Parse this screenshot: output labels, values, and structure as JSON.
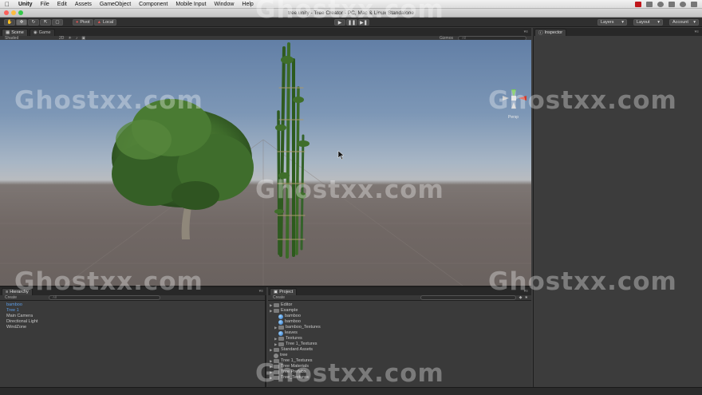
{
  "menubar": {
    "app": "Unity",
    "items": [
      "File",
      "Edit",
      "Assets",
      "GameObject",
      "Component",
      "Mobile Input",
      "Window",
      "Help"
    ]
  },
  "window": {
    "title": "tree.unity - Tree Creator - PC, Mac & Linux Standalone"
  },
  "toolbar": {
    "pivot": "Pivot",
    "local": "Local",
    "layers": "Layers",
    "layout": "Layout",
    "account": "Account"
  },
  "scene_panel": {
    "tabs": [
      "Scene",
      "Game"
    ],
    "shading_mode": "Shaded",
    "gizmos": "Gizmos",
    "search_placeholder": "All",
    "view_label": "Persp"
  },
  "inspector": {
    "tab": "Inspector"
  },
  "hierarchy": {
    "tab": "Hierarchy",
    "create": "Create",
    "search_placeholder": "All",
    "items": [
      "bamboo",
      "Tree 1",
      "Main Camera",
      "Directional Light",
      "WindZone"
    ]
  },
  "project": {
    "tab": "Project",
    "create": "Create",
    "items": [
      {
        "label": "Editor",
        "indent": 0,
        "kind": "folder"
      },
      {
        "label": "Example",
        "indent": 0,
        "kind": "folder"
      },
      {
        "label": "bamboo",
        "indent": 1,
        "kind": "object"
      },
      {
        "label": "bamboo",
        "indent": 1,
        "kind": "object"
      },
      {
        "label": "bamboo_Textures",
        "indent": 1,
        "kind": "folder"
      },
      {
        "label": "leaves",
        "indent": 1,
        "kind": "object"
      },
      {
        "label": "Textures",
        "indent": 1,
        "kind": "folder"
      },
      {
        "label": "Tree 1_Textures",
        "indent": 1,
        "kind": "folder"
      },
      {
        "label": "Standard Assets",
        "indent": 0,
        "kind": "folder"
      },
      {
        "label": "tree",
        "indent": 0,
        "kind": "scene"
      },
      {
        "label": "Tree 1_Textures",
        "indent": 0,
        "kind": "folder"
      },
      {
        "label": "Tree Materials",
        "indent": 0,
        "kind": "folder"
      },
      {
        "label": "Tree Prefabs",
        "indent": 0,
        "kind": "folder"
      },
      {
        "label": "Tree_Textures",
        "indent": 0,
        "kind": "folder"
      }
    ]
  },
  "watermark": "Ghostxx.com",
  "colors": {
    "selection": "#5d9de6",
    "record_red": "#c0161b",
    "mac_close": "#fc605b",
    "mac_min": "#fdbc40",
    "mac_max": "#34c84a"
  }
}
